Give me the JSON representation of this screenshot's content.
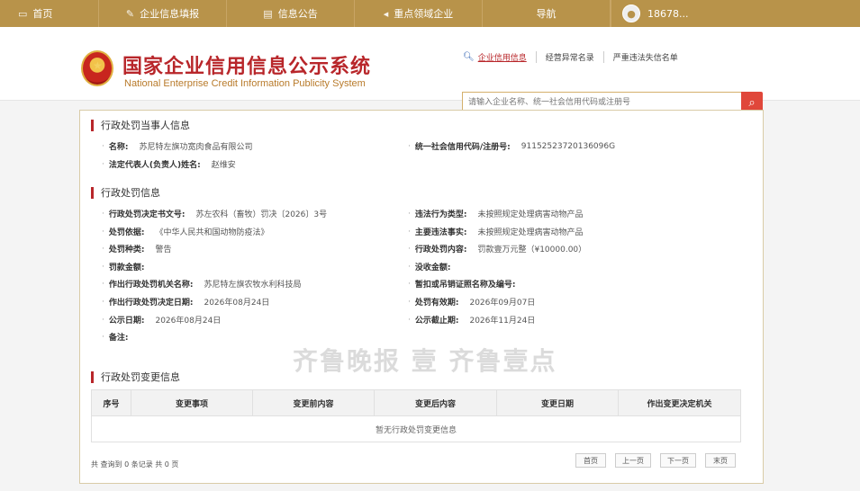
{
  "topnav": {
    "items": [
      {
        "label": "首页",
        "icon": "monitor-icon"
      },
      {
        "label": "企业信息填报",
        "icon": "edit-icon"
      },
      {
        "label": "信息公告",
        "icon": "document-icon"
      },
      {
        "label": "重点领域企业",
        "icon": "megaphone-icon"
      },
      {
        "label": "导航",
        "icon": ""
      }
    ],
    "user": "18678..."
  },
  "header": {
    "title": "国家企业信用信息公示系统",
    "subtitle": "National Enterprise Credit Information Publicity System"
  },
  "search": {
    "tabs": [
      "企业信用信息",
      "经营异常名录",
      "严重违法失信名单"
    ],
    "active_tab": "企业信用信息",
    "placeholder": "请输入企业名称、统一社会信用代码或注册号"
  },
  "party": {
    "title": "行政处罚当事人信息",
    "name_label": "名称:",
    "name_value": "苏尼特左旗功宽肉食品有限公司",
    "credit_label": "统一社会信用代码/注册号:",
    "credit_value": "91152523720136096G",
    "rep_label": "法定代表人(负责人)姓名:",
    "rep_value": "赵维安"
  },
  "penalty": {
    "title": "行政处罚信息",
    "fields": [
      {
        "label": "行政处罚决定书文号:",
        "value": "苏左农科（畜牧）罚决〔2026〕3号"
      },
      {
        "label": "违法行为类型:",
        "value": "未按照规定处理病害动物产品"
      },
      {
        "label": "处罚依据:",
        "value": "《中华人民共和国动物防疫法》"
      },
      {
        "label": "主要违法事实:",
        "value": "未按照规定处理病害动物产品"
      },
      {
        "label": "处罚种类:",
        "value": "警告"
      },
      {
        "label": "行政处罚内容:",
        "value": "罚款壹万元整（¥10000.00）"
      },
      {
        "label": "罚款金额:",
        "value": ""
      },
      {
        "label": "没收金额:",
        "value": ""
      },
      {
        "label": "作出行政处罚机关名称:",
        "value": "苏尼特左旗农牧水利科技局"
      },
      {
        "label": "暂扣或吊销证照名称及编号:",
        "value": ""
      },
      {
        "label": "作出行政处罚决定日期:",
        "value": "2026年08月24日"
      },
      {
        "label": "处罚有效期:",
        "value": "2026年09月07日"
      },
      {
        "label": "公示日期:",
        "value": "2026年08月24日"
      },
      {
        "label": "公示截止期:",
        "value": "2026年11月24日"
      },
      {
        "label": "备注:",
        "value": ""
      }
    ]
  },
  "changes": {
    "title": "行政处罚变更信息",
    "columns": [
      "序号",
      "变更事项",
      "变更前内容",
      "变更后内容",
      "变更日期",
      "作出变更决定机关"
    ],
    "empty_text": "暂无行政处罚变更信息",
    "summary": "共 查询到 0 条记录 共 0 页",
    "pager": [
      "首页",
      "上一页",
      "下一页",
      "末页"
    ]
  },
  "watermark": "齐鲁晚报 壹 齐鲁壹点"
}
